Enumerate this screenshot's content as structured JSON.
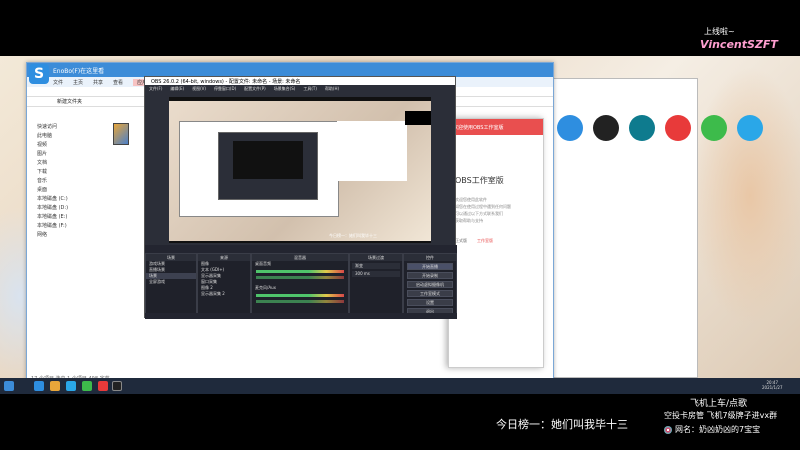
{
  "overlay": {
    "brand_tag": "上线啦~",
    "brand_name": "VincentSZFT",
    "ticker": "今日榜一：她们叫我毕十三",
    "info_line1": "飞机上车/点歌",
    "info_line2": "空投卡房管 飞机7级牌子进vx群",
    "info_line3": "网名：奶凶奶凶的7宝宝"
  },
  "explorer": {
    "title": "EnoBo(F)在这里看",
    "tabs": [
      "文件",
      "主页",
      "共享",
      "查看",
      "应用程序工具"
    ],
    "addr": "新建文件夹",
    "sidebar": [
      "快速访问",
      "此电脑",
      "视频",
      "图片",
      "文档",
      "下载",
      "音乐",
      "桌面",
      "本地磁盘 (C:)",
      "本地磁盘 (D:)",
      "本地磁盘 (E:)",
      "本地磁盘 (F:)",
      "网络"
    ],
    "status": "17 个项目   选中 1 个项目 498 字节"
  },
  "obs_setup": {
    "head": "欢迎使用OBS工作室版",
    "title": "OBS工作室版",
    "lines": [
      "欢迎您使用此软件",
      "如您在使用过程中遇到任何问题",
      "可以通过以下方式联系我们",
      "获取帮助与支持"
    ],
    "opt1": "正式版",
    "opt2": "工作室版"
  },
  "obs": {
    "title": "OBS 26.0.2 (64-bit, windows) - 配置文件: 未命名 - 场景: 未命名",
    "menus": [
      "文件(F)",
      "编辑(E)",
      "视图(V)",
      "停靠窗口(D)",
      "配置文件(P)",
      "场景集合(S)",
      "工具(T)",
      "帮助(H)"
    ],
    "scenes_head": "场景",
    "scenes": [
      "游戏场景",
      "直播场景",
      "场景",
      "全屏游戏"
    ],
    "sources_head": "来源",
    "sources": [
      "图像",
      "文本 (GDI+)",
      "显示器采集",
      "窗口采集",
      "图像 2",
      "显示器采集 2"
    ],
    "mixer_head": "混音器",
    "mixer_tracks": [
      "桌面音频",
      "麦克风/Aux"
    ],
    "transition_head": "场景过渡",
    "transition": "渐变",
    "duration": "300 ms",
    "controls_head": "控件",
    "controls": [
      "开始直播",
      "开始录制",
      "启动虚拟摄像机",
      "工作室模式",
      "设置",
      "退出"
    ],
    "status_time": "LIVE: 00:00:00  REC: 00:00:00  CPU: 2.3%, 30.00 fps"
  },
  "clock": {
    "time": "20:47",
    "date": "2021/1/27"
  }
}
